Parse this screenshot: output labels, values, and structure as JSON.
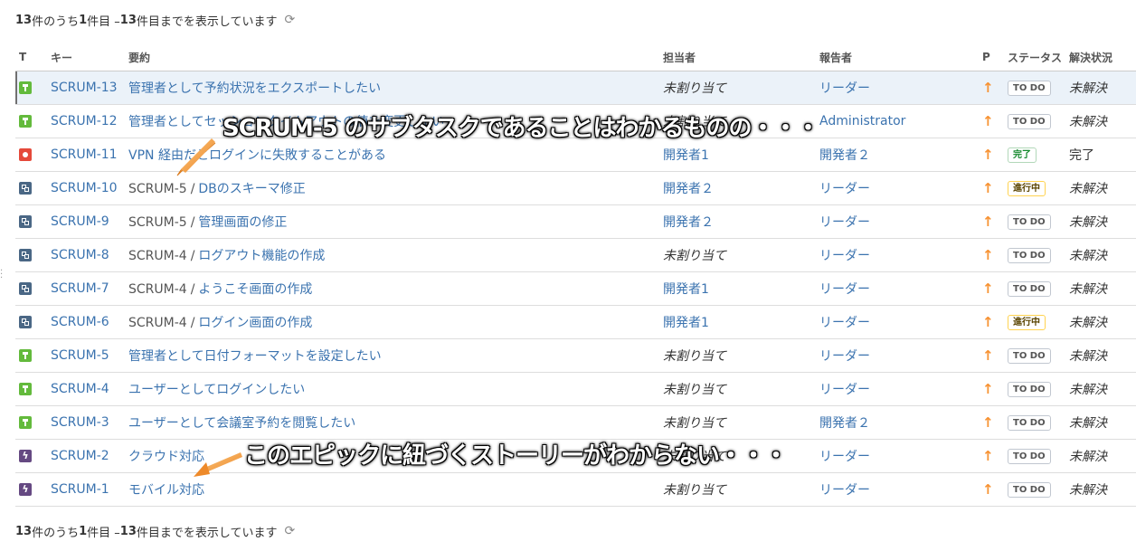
{
  "pager": {
    "prefix_total": "13",
    "text1": " 件のうち ",
    "start": "1",
    "text2": " 件目 – ",
    "end": "13",
    "text3": " 件目までを表示しています"
  },
  "columns": {
    "type": "T",
    "key": "キー",
    "summary": "要約",
    "assignee": "担当者",
    "reporter": "報告者",
    "priority": "P",
    "status": "ステータス",
    "resolution": "解決状況"
  },
  "rows": [
    {
      "type": "story",
      "key": "SCRUM-13",
      "parent": "",
      "summary": "管理者として予約状況をエクスポートしたい",
      "assignee": "未割り当て",
      "reporter": "リーダー",
      "status": "TO DO",
      "resolution": "未解決"
    },
    {
      "type": "story",
      "key": "SCRUM-12",
      "parent": "",
      "summary": "管理者としてセッションタイムアウトの値を変更したい",
      "assignee": "未割り当て",
      "reporter": "Administrator",
      "status": "TO DO",
      "resolution": "未解決"
    },
    {
      "type": "bug",
      "key": "SCRUM-11",
      "parent": "",
      "summary": "VPN 経由だとログインに失敗することがある",
      "assignee": "開発者1",
      "reporter": "開発者２",
      "status": "完了",
      "resolution": "完了"
    },
    {
      "type": "subtask",
      "key": "SCRUM-10",
      "parent": "SCRUM-5",
      "summary": "DBのスキーマ修正",
      "assignee": "開発者２",
      "reporter": "リーダー",
      "status": "進行中",
      "resolution": "未解決"
    },
    {
      "type": "subtask",
      "key": "SCRUM-9",
      "parent": "SCRUM-5",
      "summary": "管理画面の修正",
      "assignee": "開発者２",
      "reporter": "リーダー",
      "status": "TO DO",
      "resolution": "未解決"
    },
    {
      "type": "subtask",
      "key": "SCRUM-8",
      "parent": "SCRUM-4",
      "summary": "ログアウト機能の作成",
      "assignee": "未割り当て",
      "reporter": "リーダー",
      "status": "TO DO",
      "resolution": "未解決"
    },
    {
      "type": "subtask",
      "key": "SCRUM-7",
      "parent": "SCRUM-4",
      "summary": "ようこそ画面の作成",
      "assignee": "開発者1",
      "reporter": "リーダー",
      "status": "TO DO",
      "resolution": "未解決"
    },
    {
      "type": "subtask",
      "key": "SCRUM-6",
      "parent": "SCRUM-4",
      "summary": "ログイン画面の作成",
      "assignee": "開発者1",
      "reporter": "リーダー",
      "status": "進行中",
      "resolution": "未解決"
    },
    {
      "type": "story",
      "key": "SCRUM-5",
      "parent": "",
      "summary": "管理者として日付フォーマットを設定したい",
      "assignee": "未割り当て",
      "reporter": "リーダー",
      "status": "TO DO",
      "resolution": "未解決"
    },
    {
      "type": "story",
      "key": "SCRUM-4",
      "parent": "",
      "summary": "ユーザーとしてログインしたい",
      "assignee": "未割り当て",
      "reporter": "リーダー",
      "status": "TO DO",
      "resolution": "未解決"
    },
    {
      "type": "story",
      "key": "SCRUM-3",
      "parent": "",
      "summary": "ユーザーとして会議室予約を閲覧したい",
      "assignee": "未割り当て",
      "reporter": "開発者２",
      "status": "TO DO",
      "resolution": "未解決"
    },
    {
      "type": "epic",
      "key": "SCRUM-2",
      "parent": "",
      "summary": "クラウド対応",
      "assignee": "未割り当て",
      "reporter": "リーダー",
      "status": "TO DO",
      "resolution": "未解決"
    },
    {
      "type": "epic",
      "key": "SCRUM-1",
      "parent": "",
      "summary": "モバイル対応",
      "assignee": "未割り当て",
      "reporter": "リーダー",
      "status": "TO DO",
      "resolution": "未解決"
    }
  ],
  "annotations": {
    "callout1": "SCRUM-5 のサブタスクであることはわかるものの・・・",
    "callout2": "このエピックに紐づくストーリーがわからない・・・"
  },
  "colors": {
    "link": "#3b73af",
    "arrow": "#f79232",
    "callout_arrow": "#f5a04a"
  }
}
